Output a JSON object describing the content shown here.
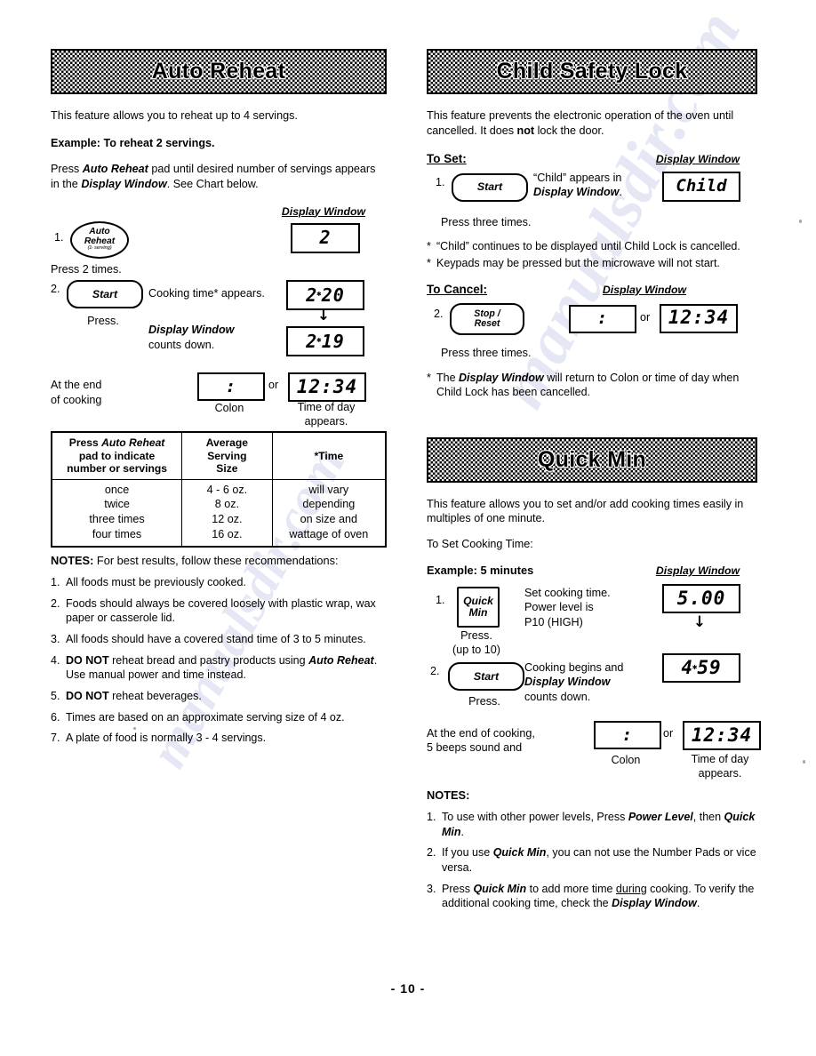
{
  "page": {
    "footer": "- 10 -",
    "watermark": "manualsdir.com"
  },
  "auto_reheat": {
    "title": "Auto Reheat",
    "intro": "This feature allows you to reheat up to 4 servings.",
    "example": "Example: To reheat 2 servings.",
    "instruction_1": "Press ",
    "instruction_pad": "Auto Reheat",
    "instruction_2": " pad until desired number of servings appears in the ",
    "instruction_dw": "Display Window",
    "instruction_3": ".  See Chart below.",
    "display_window_label": "Display Window",
    "step1": {
      "num": "1.",
      "pad_line1": "Auto",
      "pad_line2": "Reheat",
      "pad_line3": "(1- serving)",
      "display": "2",
      "press": "Press 2 times."
    },
    "step2": {
      "num": "2.",
      "pad": "Start",
      "press": "Press.",
      "desc": "Cooking time* appears.",
      "desc2_bold": "Display Window",
      "desc2_rest": "counts down.",
      "display_a_pre": "2",
      "display_a_post": "20",
      "display_b_pre": "2",
      "display_b_post": "19"
    },
    "end": {
      "label_line1": "At the end",
      "label_line2": "of cooking",
      "colon": ":",
      "colon_caption": "Colon",
      "or": "or",
      "time": "12:34",
      "time_caption_line1": "Time of day",
      "time_caption_line2": "appears."
    },
    "table": {
      "headers": [
        "Press Auto Reheat pad to indicate number or servings",
        "Average Serving Size",
        "*Time"
      ],
      "header_col1_line1": "Press ",
      "header_col1_italic": "Auto Reheat",
      "header_col1_line2": "pad to indicate",
      "header_col1_line3": "number or servings",
      "header_col2_line1": "Average",
      "header_col2_line2": "Serving",
      "header_col2_line3": "Size",
      "header_col3": "*Time",
      "col1_values": [
        "once",
        "twice",
        "three times",
        "four times"
      ],
      "col2_values": [
        "4 - 6 oz.",
        "8 oz.",
        "12 oz.",
        "16 oz."
      ],
      "col3_values": [
        "will vary",
        "depending",
        "on size and",
        "wattage of oven"
      ]
    },
    "notes_head_bold": "NOTES:",
    "notes_head_rest": "  For best results, follow these recommendations:",
    "notes": [
      {
        "n": "1.",
        "text": "All foods must be previously cooked."
      },
      {
        "n": "2.",
        "text": "Foods should always be covered loosely with plastic wrap, wax paper or casserole lid."
      },
      {
        "n": "3.",
        "text": "All foods should have a covered stand time of 3 to 5 minutes."
      },
      {
        "n": "4.",
        "pre_bold": "DO NOT",
        "mid": " reheat bread and pastry products using ",
        "ital": "Auto Reheat",
        "post": ".  Use manual power and time instead."
      },
      {
        "n": "5.",
        "pre_bold": "DO NOT",
        "mid": " reheat beverages."
      },
      {
        "n": "6.",
        "text": "Times are based on an approximate serving size of 4 oz."
      },
      {
        "n": "7.",
        "text": "A plate of food is normally 3 - 4 servings."
      }
    ]
  },
  "child_lock": {
    "title": "Child Safety Lock",
    "intro_1": "This feature prevents the electronic operation of the oven until cancelled. It does ",
    "intro_bold": "not",
    "intro_2": " lock the door.",
    "to_set": "To Set:",
    "display_window_label": "Display Window",
    "step1": {
      "num": "1.",
      "pad": "Start",
      "desc_1": "“Child” appears in",
      "desc_2": "Display Window",
      "desc_3": ".",
      "display": "Child",
      "press": "Press three times."
    },
    "asterisks_set": [
      "“Child” continues to be displayed until Child Lock is cancelled.",
      "Keypads may be pressed but the microwave will not start."
    ],
    "to_cancel": "To Cancel:",
    "display_window_label_2": "Display Window",
    "step2": {
      "num": "2.",
      "pad_line1": "Stop /",
      "pad_line2": "Reset",
      "colon": ":",
      "or": "or",
      "time": "12:34",
      "press": "Press three times."
    },
    "asterisk_cancel_1": "The ",
    "asterisk_cancel_ital": "Display Window",
    "asterisk_cancel_2": " will return to Colon or time of day when Child Lock has been cancelled."
  },
  "quick_min": {
    "title": "Quick Min",
    "intro": "This feature allows you to set and/or add cooking times easily in multiples of one minute.",
    "to_set": "To Set Cooking Time:",
    "example": "Example: 5 minutes",
    "display_window_label": "Display Window",
    "step1": {
      "num": "1.",
      "pad_line1": "Quick",
      "pad_line2": "Min",
      "press": "Press.",
      "press_sub": "(up to 10)",
      "desc_line1": "Set cooking time.",
      "desc_line2": "Power level is",
      "desc_line3": "P10  (HIGH)",
      "display": "5.00"
    },
    "step2": {
      "num": "2.",
      "pad": "Start",
      "press": "Press.",
      "desc_line1": "Cooking begins and",
      "desc_bold": "Display Window",
      "desc_line3": "counts down.",
      "display_pre": "4",
      "display_post": "59"
    },
    "end": {
      "label_line1": "At the end of cooking,",
      "label_line2": "5 beeps sound and",
      "colon": ":",
      "colon_caption": "Colon",
      "or": "or",
      "time": "12:34",
      "time_caption_line1": "Time of day",
      "time_caption_line2": "appears."
    },
    "notes_head": "NOTES:",
    "notes": [
      {
        "n": "1.",
        "pre": "To use with other power levels, Press ",
        "ital": "Power Level",
        "mid": ", then ",
        "ital2": "Quick Min",
        "post": "."
      },
      {
        "n": "2.",
        "pre": "If you use ",
        "ital": "Quick Min",
        "mid": ", you can not use the Number Pads or vice versa."
      },
      {
        "n": "3.",
        "pre": "Press ",
        "ital": "Quick Min",
        "mid": " to add more time ",
        "ul": "during",
        "mid2": " cooking.  To verify the additional cooking time, check the ",
        "ital2": "Display Window",
        "post": "."
      }
    ]
  }
}
